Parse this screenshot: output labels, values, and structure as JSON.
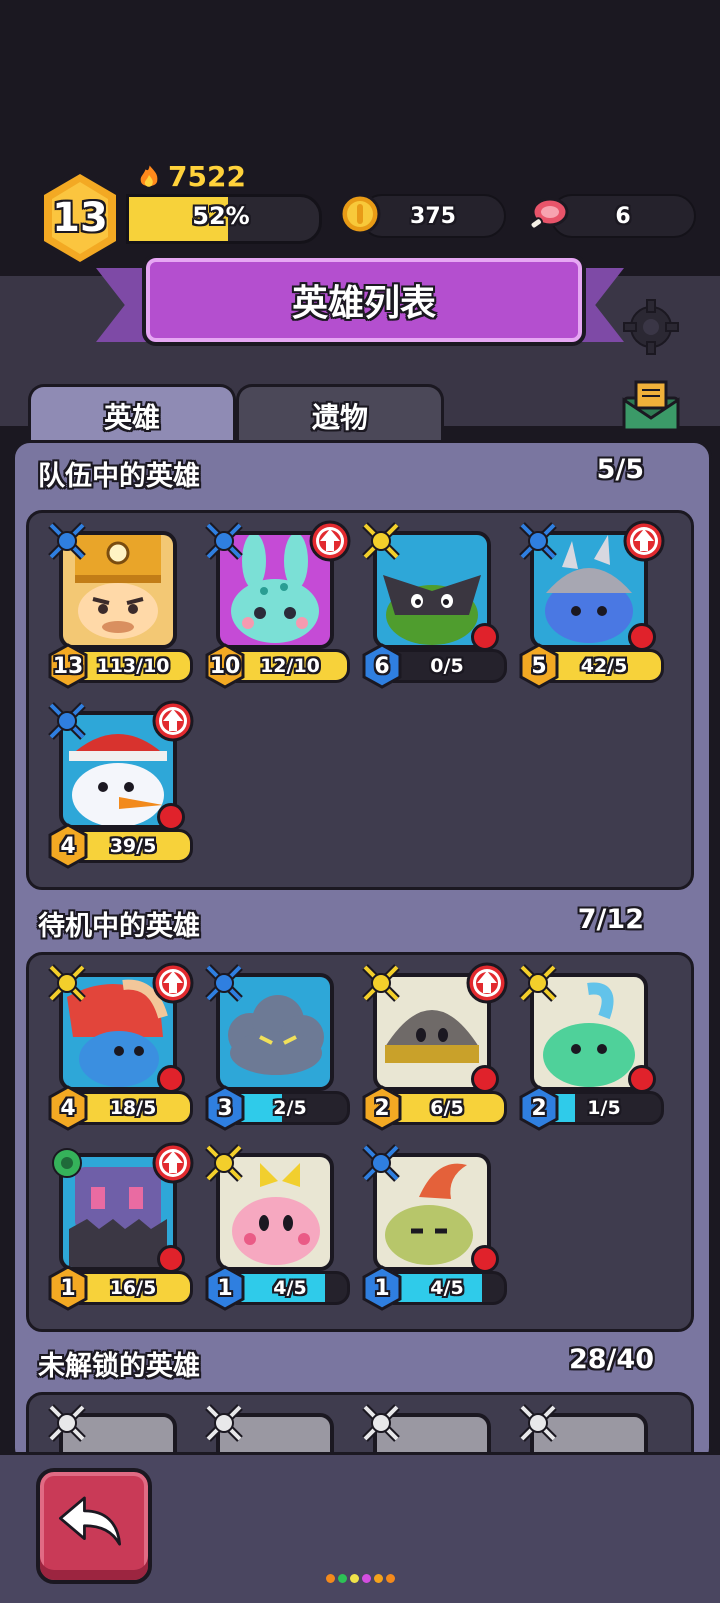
{
  "player": {
    "level": "13",
    "power": "7522",
    "xp_percent_label": "52%",
    "xp_percent": 52
  },
  "resources": {
    "coins": "375",
    "meat": "6"
  },
  "banner": {
    "title": "英雄列表"
  },
  "tabs": [
    {
      "label": "英雄",
      "active": true
    },
    {
      "label": "遗物",
      "active": false
    }
  ],
  "sections": {
    "team": {
      "title": "队伍中的英雄",
      "count": "5/5"
    },
    "standby": {
      "title": "待机中的英雄",
      "count": "7/12"
    },
    "locked": {
      "title": "未解锁的英雄",
      "count": "28/40"
    }
  },
  "team_heroes": [
    {
      "level": "13",
      "progress": "113/10",
      "fill": 1.0,
      "bar": "yellow",
      "class": "blue",
      "upgrade": false,
      "dot": false,
      "portrait": "miner"
    },
    {
      "level": "10",
      "progress": "12/10",
      "fill": 1.0,
      "bar": "yellow",
      "class": "blue",
      "upgrade": true,
      "dot": false,
      "portrait": "bunny"
    },
    {
      "level": "6",
      "progress": "0/5",
      "fill": 0.0,
      "bar": "cyan",
      "class": "yellow",
      "upgrade": false,
      "dot": true,
      "portrait": "ninja"
    },
    {
      "level": "5",
      "progress": "42/5",
      "fill": 1.0,
      "bar": "yellow",
      "class": "blue",
      "upgrade": true,
      "dot": true,
      "portrait": "spiky"
    },
    {
      "level": "4",
      "progress": "39/5",
      "fill": 1.0,
      "bar": "yellow",
      "class": "blue",
      "upgrade": true,
      "dot": true,
      "portrait": "snowman"
    }
  ],
  "standby_heroes": [
    {
      "level": "4",
      "progress": "18/5",
      "fill": 1.0,
      "bar": "yellow",
      "class": "yellow",
      "upgrade": true,
      "dot": true,
      "portrait": "rooster"
    },
    {
      "level": "3",
      "progress": "2/5",
      "fill": 0.4,
      "bar": "cyan",
      "class": "blue",
      "upgrade": false,
      "dot": false,
      "portrait": "cloud"
    },
    {
      "level": "2",
      "progress": "6/5",
      "fill": 1.0,
      "bar": "yellow",
      "class": "yellow",
      "upgrade": true,
      "dot": true,
      "portrait": "helmet"
    },
    {
      "level": "2",
      "progress": "1/5",
      "fill": 0.2,
      "bar": "cyan",
      "class": "yellow",
      "upgrade": false,
      "dot": true,
      "portrait": "slime"
    },
    {
      "level": "1",
      "progress": "16/5",
      "fill": 1.0,
      "bar": "yellow",
      "class": "green",
      "upgrade": true,
      "dot": true,
      "portrait": "robot"
    },
    {
      "level": "1",
      "progress": "4/5",
      "fill": 0.8,
      "bar": "cyan",
      "class": "yellow",
      "upgrade": false,
      "dot": false,
      "portrait": "kirby"
    },
    {
      "level": "1",
      "progress": "4/5",
      "fill": 0.8,
      "bar": "cyan",
      "class": "blue",
      "upgrade": false,
      "dot": true,
      "portrait": "sprout"
    }
  ],
  "colors": {
    "gold": "#f7d23a",
    "cyan": "#2fcbea",
    "hex_gold": "#f3a923",
    "hex_blue": "#2f7fe0",
    "panel": "#7a76a0",
    "banner": "#b44fcf",
    "back_button": "#c93a57"
  }
}
